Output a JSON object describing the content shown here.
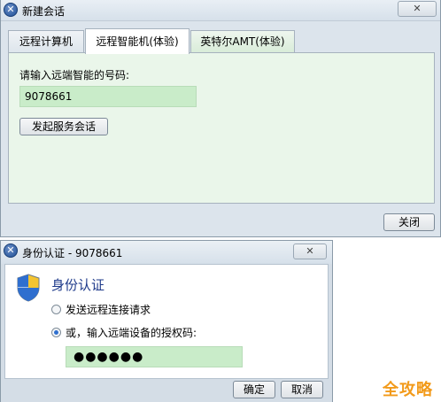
{
  "window1": {
    "title": "新建会话",
    "close_glyph": "✕",
    "tabs": [
      {
        "label": "远程计算机"
      },
      {
        "label": "远程智能机(体验)"
      },
      {
        "label": "英特尔AMT(体验)"
      }
    ],
    "active_tab": 1,
    "prompt": "请输入远端智能的号码:",
    "code_value": "9078661",
    "start_button": "发起服务会话",
    "close_button": "关闭"
  },
  "window2": {
    "title": "身份认证 - 9078661",
    "close_glyph": "✕",
    "heading": "身份认证",
    "option1": "发送远程连接请求",
    "option2": "或，输入远端设备的授权码:",
    "selected_option": 2,
    "password_mask": "●●●●●●",
    "ok_button": "确定",
    "cancel_button": "取消"
  },
  "watermark": "全攻略",
  "colors": {
    "field_green": "#c9ecc9",
    "panel_green": "#eaf6ea",
    "heading_blue": "#1e3a8a",
    "watermark_orange": "#f29a1a"
  }
}
